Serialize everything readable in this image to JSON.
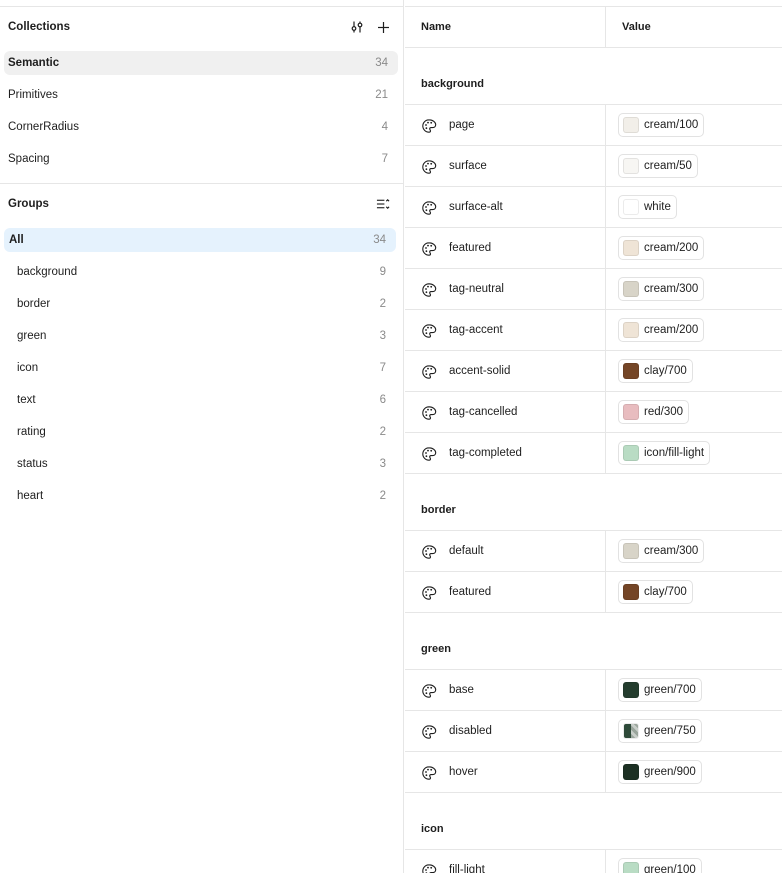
{
  "collections": {
    "title": "Collections",
    "items": [
      {
        "label": "Semantic",
        "count": "34"
      },
      {
        "label": "Primitives",
        "count": "21"
      },
      {
        "label": "CornerRadius",
        "count": "4"
      },
      {
        "label": "Spacing",
        "count": "7"
      }
    ]
  },
  "groups": {
    "title": "Groups",
    "items": [
      {
        "label": "All",
        "count": "34"
      },
      {
        "label": "background",
        "count": "9"
      },
      {
        "label": "border",
        "count": "2"
      },
      {
        "label": "green",
        "count": "3"
      },
      {
        "label": "icon",
        "count": "7"
      },
      {
        "label": "text",
        "count": "6"
      },
      {
        "label": "rating",
        "count": "2"
      },
      {
        "label": "status",
        "count": "3"
      },
      {
        "label": "heart",
        "count": "2"
      }
    ]
  },
  "table": {
    "col_name": "Name",
    "col_value": "Value",
    "sections": [
      {
        "title": "background",
        "rows": [
          {
            "name": "page",
            "value": "cream/100",
            "color": "#f2efe9"
          },
          {
            "name": "surface",
            "value": "cream/50",
            "color": "#f7f6f3"
          },
          {
            "name": "surface-alt",
            "value": "white",
            "color": "#ffffff"
          },
          {
            "name": "featured",
            "value": "cream/200",
            "color": "#efe4d6"
          },
          {
            "name": "tag-neutral",
            "value": "cream/300",
            "color": "#d8d4c8"
          },
          {
            "name": "tag-accent",
            "value": "cream/200",
            "color": "#efe4d6"
          },
          {
            "name": "accent-solid",
            "value": "clay/700",
            "color": "#744526"
          },
          {
            "name": "tag-cancelled",
            "value": "red/300",
            "color": "#e8bcbf"
          },
          {
            "name": "tag-completed",
            "value": "icon/fill-light",
            "color": "#b9dcc4"
          }
        ]
      },
      {
        "title": "border",
        "rows": [
          {
            "name": "default",
            "value": "cream/300",
            "color": "#d8d4c8"
          },
          {
            "name": "featured",
            "value": "clay/700",
            "color": "#744526"
          }
        ]
      },
      {
        "title": "green",
        "rows": [
          {
            "name": "base",
            "value": "green/700",
            "color": "#243d2e"
          },
          {
            "name": "disabled",
            "value": "green/750",
            "color": "#2e4a39",
            "split": true
          },
          {
            "name": "hover",
            "value": "green/900",
            "color": "#1c3023"
          }
        ]
      },
      {
        "title": "icon",
        "rows": [
          {
            "name": "fill-light",
            "value": "green/100",
            "color": "#b9dcc4"
          }
        ]
      }
    ]
  }
}
